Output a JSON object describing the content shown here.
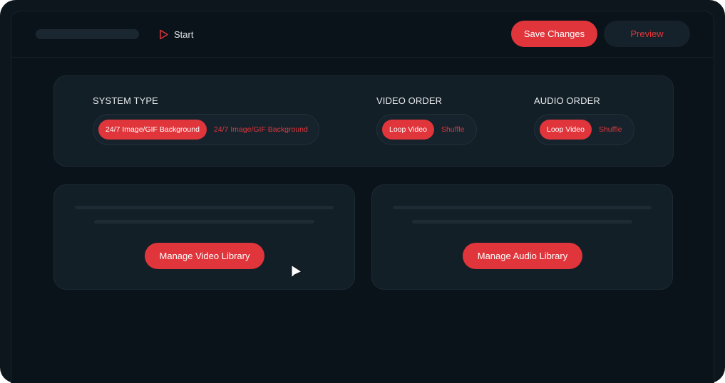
{
  "header": {
    "start_label": "Start",
    "save_label": "Save Changes",
    "preview_label": "Preview"
  },
  "settings": {
    "system_type": {
      "title": "SYSTEM TYPE",
      "options": [
        "24/7 Image/GIF Background",
        "24/7 Image/GIF Background"
      ],
      "selected": "24/7 Image/GIF Background"
    },
    "video_order": {
      "title": "VIDEO ORDER",
      "options": [
        "Loop Video",
        "Shuffle"
      ],
      "selected": "Loop Video"
    },
    "audio_order": {
      "title": "AUDIO ORDER",
      "options": [
        "Loop Video",
        "Shuffle"
      ],
      "selected": "Loop Video"
    }
  },
  "video_library": {
    "button_label": "Manage Video Library"
  },
  "audio_library": {
    "button_label": "Manage Audio Library"
  },
  "colors": {
    "accent": "#e0353b",
    "background": "#0a131a",
    "card": "#131f27",
    "text": "#e6e9ec"
  },
  "icons": {
    "start": "play-outline-icon",
    "cursor": "mouse-pointer-icon"
  }
}
